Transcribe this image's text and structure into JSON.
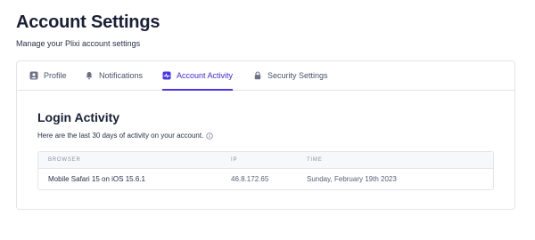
{
  "header": {
    "title": "Account Settings",
    "subtitle": "Manage your Plixi account settings"
  },
  "tabs": [
    {
      "label": "Profile",
      "icon": "user-icon",
      "active": false
    },
    {
      "label": "Notifications",
      "icon": "bell-icon",
      "active": false
    },
    {
      "label": "Account Activity",
      "icon": "activity-icon",
      "active": true
    },
    {
      "label": "Security Settings",
      "icon": "lock-icon",
      "active": false
    }
  ],
  "login_activity": {
    "title": "Login Activity",
    "description": "Here are the last 30 days of activity on your account.",
    "columns": [
      "BROWSER",
      "IP",
      "TIME"
    ],
    "rows": [
      {
        "browser": "Mobile Safari 15 on iOS 15.6.1",
        "ip": "46.8.172.65",
        "time": "Sunday, February 19th 2023"
      }
    ]
  },
  "colors": {
    "accent": "#4a36e6",
    "text": "#1a1f36",
    "border": "#e3e5ea"
  }
}
